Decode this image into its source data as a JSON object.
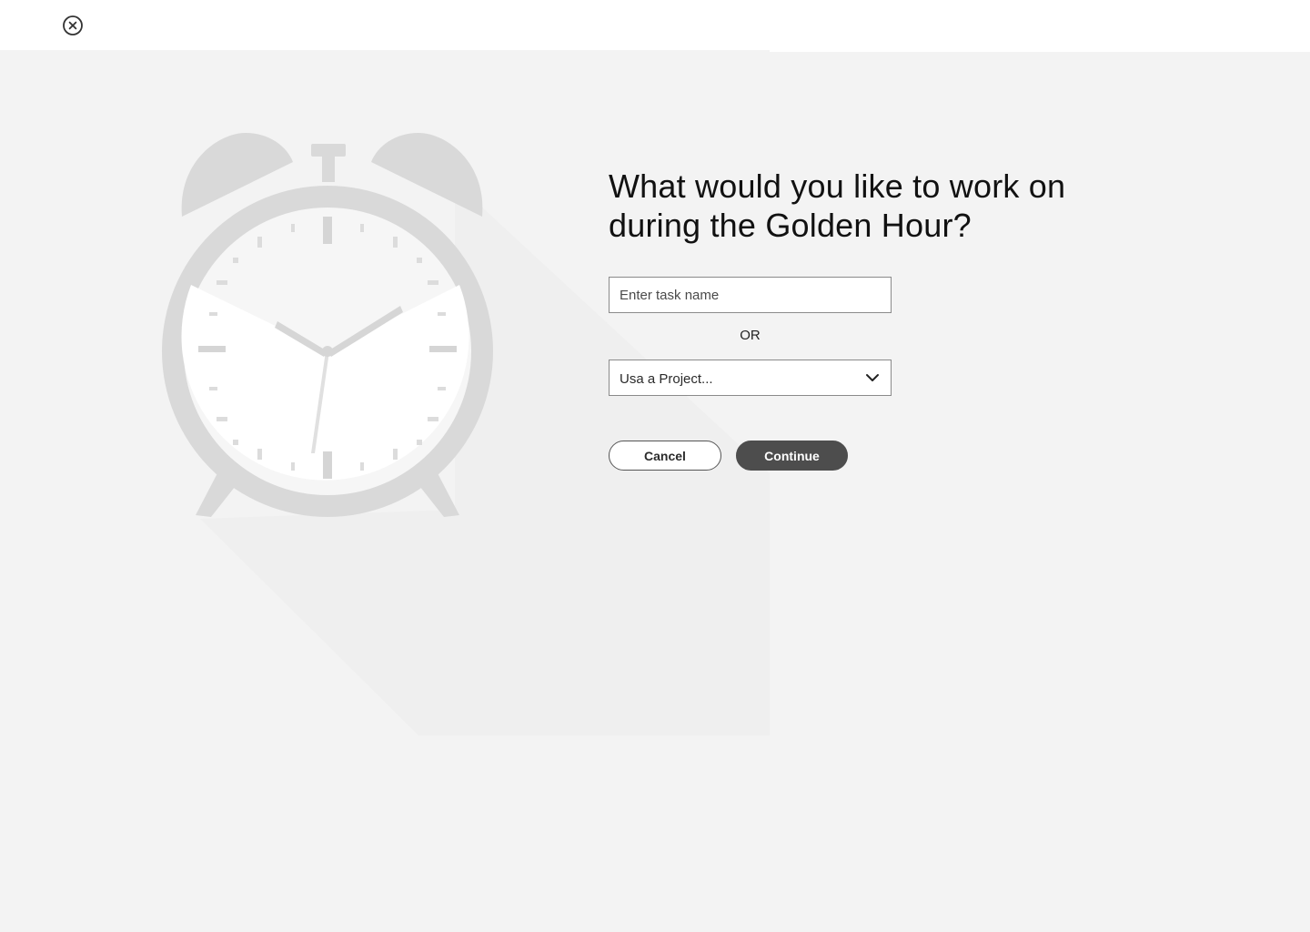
{
  "header": {
    "close_icon": "close-circle-icon"
  },
  "illustration": {
    "icon": "alarm-clock-icon",
    "colors": {
      "body": "#d9d9d9",
      "face": "#ffffff",
      "marks": "#d5d5d5",
      "shadow": "#efefef"
    }
  },
  "form": {
    "heading": "What would you like to work on during the Golden Hour?",
    "task_input": {
      "placeholder": "Enter task name",
      "value": ""
    },
    "separator": "OR",
    "project_select": {
      "selected": "Usa a Project...",
      "icon": "chevron-down-icon"
    },
    "cancel_label": "Cancel",
    "continue_label": "Continue"
  },
  "colors": {
    "background": "#f3f3f3",
    "topbar": "#ffffff",
    "primary_button": "#4d4d4d"
  }
}
